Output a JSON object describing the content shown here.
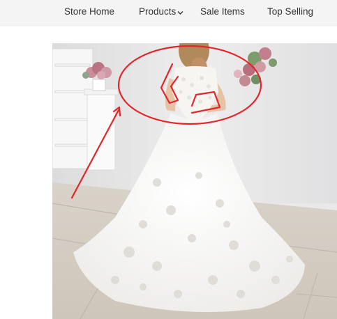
{
  "nav": {
    "items": [
      {
        "label": "Store Home"
      },
      {
        "label": "Products",
        "icon": "chevron-down-icon"
      },
      {
        "label": "Sale Items"
      },
      {
        "label": "Top Selling"
      }
    ]
  },
  "product_image": {
    "subject": "white lace ball gown wedding dress",
    "annotation_color": "#e3262b"
  },
  "colors": {
    "nav_background": "#f4f4f4",
    "nav_text": "#333333",
    "annotation": "#e3262b"
  }
}
